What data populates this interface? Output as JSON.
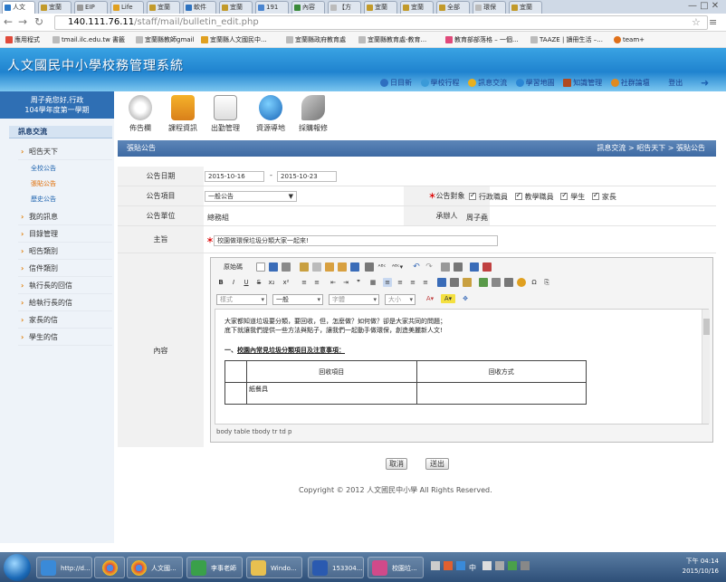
{
  "browser": {
    "tabs": [
      "人文",
      "宜蘭",
      "EIP",
      "Life",
      "宜蘭",
      "軟件",
      "宜蘭",
      "191",
      "內容",
      "【方",
      "宜蘭",
      "宜蘭",
      "全部",
      "環保",
      "宜蘭"
    ],
    "url_host": "140.111.76.11",
    "url_path": "/staff/mail/bulletin_edit.php",
    "bookmarks": [
      "應用程式",
      "tmail.ilc.edu.tw 書籤",
      "宜蘭縣教師gmail",
      "宜蘭縣人文國民中...",
      "宜蘭縣政府教育處",
      "宜蘭縣教育處-教育...",
      "教育部部落格 – 一個...",
      "TAAZE | 讀冊生活 –...",
      "team+"
    ]
  },
  "site": {
    "title": "人文國民中小學校務管理系統",
    "menu": [
      "日目新",
      "學校行程",
      "訊息交流",
      "學習地圖",
      "知識管理",
      "社群論壇",
      "登出"
    ]
  },
  "user": {
    "line1": "周子堯您好,行政",
    "line2": "104學年度第一學期"
  },
  "nav": {
    "head": "訊息交流",
    "items": [
      "昭告天下",
      "我的訊息",
      "目錄管理",
      "昭告類別",
      "信件類別",
      "執行長的回信",
      "給執行長的信",
      "家長的信",
      "學生的信"
    ],
    "subs": [
      "全校公告",
      "張貼公告",
      "歷史公告"
    ]
  },
  "tools": [
    "佈告欄",
    "課程資訊",
    "出勤管理",
    "資源導地",
    "採購報修"
  ],
  "section": {
    "title": "張貼公告",
    "breadcrumb": "訊息交流 > 昭告天下 > 張貼公告"
  },
  "form": {
    "date_label": "公告日期",
    "date_from": "2015-10-16",
    "date_sep": "-",
    "date_to": "2015-10-23",
    "item_label": "公告項目",
    "item_value": "一般公告",
    "target_label": "公告對象",
    "targets": [
      "行政職員",
      "教學職員",
      "學生",
      "家長"
    ],
    "unit_label": "公告單位",
    "unit_value": "總務組",
    "handler_label": "承辦人",
    "handler_value": "周子堯",
    "subject_label": "主旨",
    "subject_value": "校園做環保垃圾分類大家一起來!",
    "content_label": "內容"
  },
  "editor": {
    "source_btn": "原始碼",
    "style_combo": "樣式",
    "format_combo": "一般",
    "font_combo": "字體",
    "size_combo": "大小",
    "para1": "大家都知道垃圾要分類，要回收，但，怎麼做？如何做？卻是大家共同的問題；",
    "para2": "底下就讓我們提供一些方法與點子，讓我們一起動手做環保，創造美麗新人文!",
    "heading_prefix": "一、",
    "heading_text": "校園內常見垃圾分類項目及注意事項：",
    "col1": "回收項目",
    "col2": "回收方式",
    "cell1": "紙餐具",
    "path": "body  table  tbody  tr  td  p"
  },
  "buttons": {
    "cancel": "取消",
    "submit": "送出"
  },
  "footer": {
    "copyright": "Copyright © 2012 人文國民中小學 All Rights Reserved."
  },
  "taskbar": {
    "items": [
      "http://d...",
      "人文國...",
      "李事老師",
      "Windo...",
      "153304...",
      "校園垃..."
    ],
    "lang": "中",
    "time": "下午 04:14",
    "date": "2015/10/16"
  }
}
